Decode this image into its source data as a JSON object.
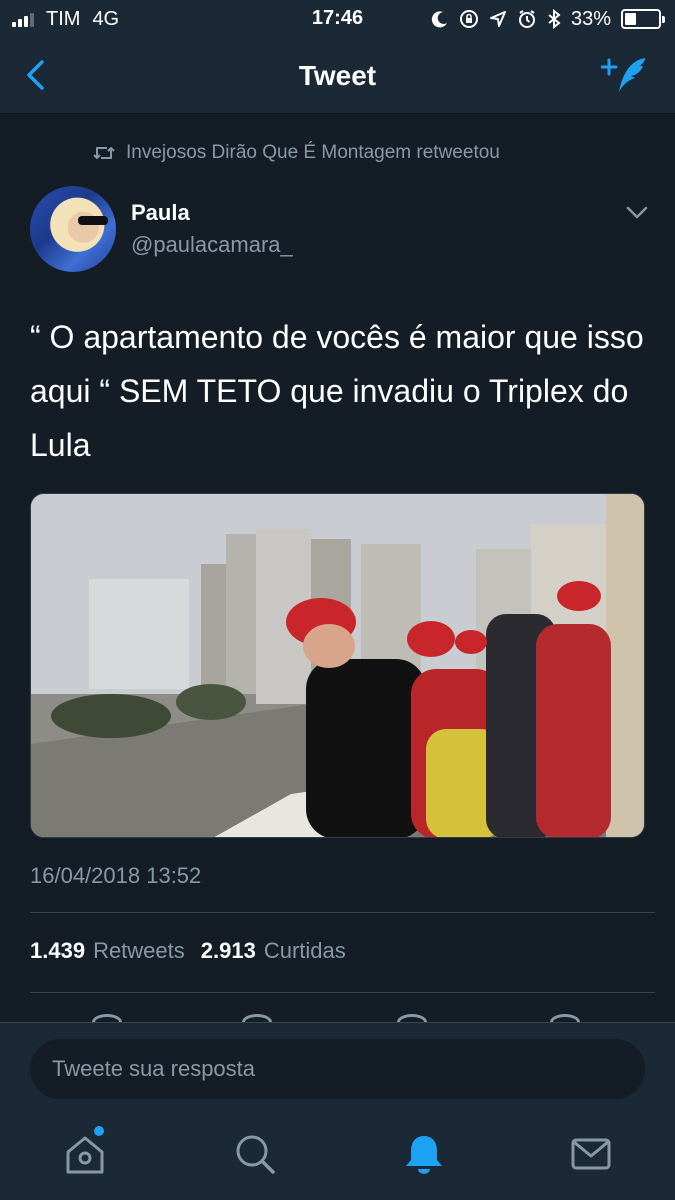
{
  "status_bar": {
    "carrier": "TIM",
    "network": "4G",
    "time": "17:46",
    "battery": "33%",
    "battery_level": 0.33
  },
  "nav": {
    "title": "Tweet",
    "back_icon": "chevron-left-icon",
    "compose_icon": "compose-tweet-icon"
  },
  "retweet_context": {
    "icon": "retweet-icon",
    "text": "Invejosos Dirão Que É Montagem retweetou"
  },
  "author": {
    "name": "Paula",
    "handle": "@paulacamara_"
  },
  "tweet": {
    "text": "“ O apartamento de vocês é maior que isso aqui “ SEM TETO que invadiu o Triplex do Lula",
    "timestamp": "16/04/2018 13:52"
  },
  "stats": {
    "retweets_count": "1.439",
    "retweets_label": "Retweets",
    "likes_count": "2.913",
    "likes_label": "Curtidas"
  },
  "reply": {
    "placeholder": "Tweete sua resposta"
  },
  "tabs": [
    {
      "name": "home",
      "icon": "home-icon",
      "has_badge": true
    },
    {
      "name": "search",
      "icon": "search-icon"
    },
    {
      "name": "notifications",
      "icon": "bell-icon",
      "active": true
    },
    {
      "name": "messages",
      "icon": "mail-icon"
    }
  ],
  "colors": {
    "background": "#141d26",
    "bar": "#1b2836",
    "accent": "#1da1f2",
    "secondary_text": "#8899a6"
  }
}
